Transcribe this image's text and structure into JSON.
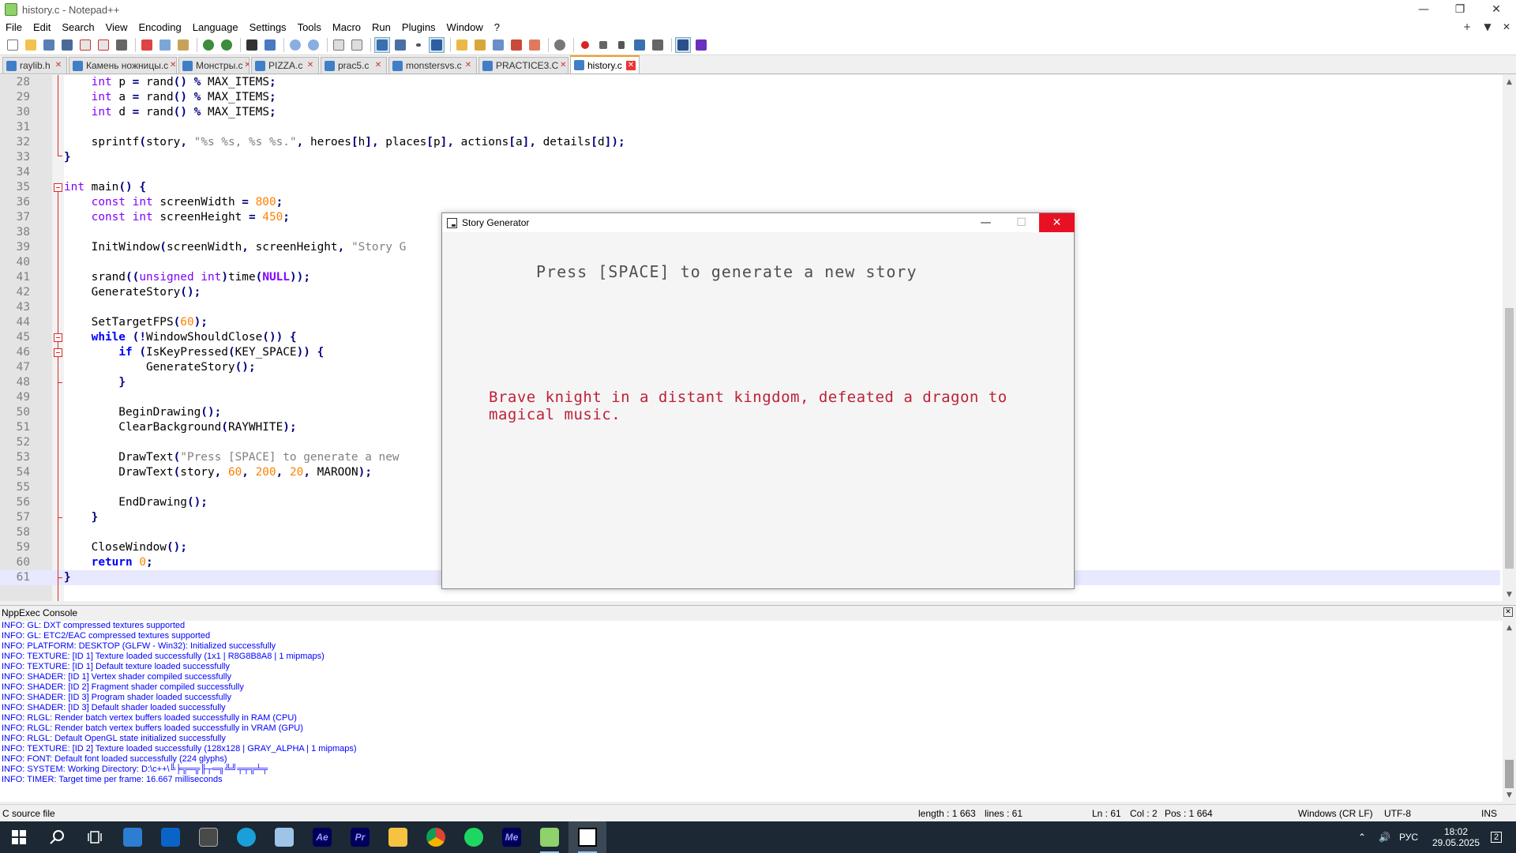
{
  "window": {
    "title": "history.c - Notepad++",
    "minimize_icon": "minimize-icon",
    "restore_icon": "restore-icon",
    "close_icon": "close-icon"
  },
  "menu": {
    "items": [
      "File",
      "Edit",
      "Search",
      "View",
      "Encoding",
      "Language",
      "Settings",
      "Tools",
      "Macro",
      "Run",
      "Plugins",
      "Window",
      "?"
    ],
    "right_controls": [
      "+",
      "▼",
      "✕"
    ]
  },
  "tabs": [
    {
      "label": "raylib.h",
      "active": false
    },
    {
      "label": "Камень ножницы.c",
      "active": false
    },
    {
      "label": "Монстры.c",
      "active": false
    },
    {
      "label": "PIZZA.c",
      "active": false
    },
    {
      "label": "prac5.c",
      "active": false
    },
    {
      "label": "monstersvs.c",
      "active": false
    },
    {
      "label": "PRACTICE3.C",
      "active": false
    },
    {
      "label": "history.c",
      "active": true
    }
  ],
  "editor": {
    "current_line": 61,
    "lines": [
      {
        "n": "28",
        "code": "    int p = rand() % MAX_ITEMS;"
      },
      {
        "n": "29",
        "code": "    int a = rand() % MAX_ITEMS;"
      },
      {
        "n": "30",
        "code": "    int d = rand() % MAX_ITEMS;"
      },
      {
        "n": "31",
        "code": ""
      },
      {
        "n": "32",
        "code": "    sprintf(story, \"%s %s, %s %s.\", heroes[h], places[p], actions[a], details[d]);"
      },
      {
        "n": "33",
        "code": "}"
      },
      {
        "n": "34",
        "code": ""
      },
      {
        "n": "35",
        "code": "int main() {"
      },
      {
        "n": "36",
        "code": "    const int screenWidth = 800;"
      },
      {
        "n": "37",
        "code": "    const int screenHeight = 450;"
      },
      {
        "n": "38",
        "code": ""
      },
      {
        "n": "39",
        "code": "    InitWindow(screenWidth, screenHeight, \"Story G"
      },
      {
        "n": "40",
        "code": ""
      },
      {
        "n": "41",
        "code": "    srand((unsigned int)time(NULL));"
      },
      {
        "n": "42",
        "code": "    GenerateStory();"
      },
      {
        "n": "43",
        "code": ""
      },
      {
        "n": "44",
        "code": "    SetTargetFPS(60);"
      },
      {
        "n": "45",
        "code": "    while (!WindowShouldClose()) {"
      },
      {
        "n": "46",
        "code": "        if (IsKeyPressed(KEY_SPACE)) {"
      },
      {
        "n": "47",
        "code": "            GenerateStory();"
      },
      {
        "n": "48",
        "code": "        }"
      },
      {
        "n": "49",
        "code": ""
      },
      {
        "n": "50",
        "code": "        BeginDrawing();"
      },
      {
        "n": "51",
        "code": "        ClearBackground(RAYWHITE);"
      },
      {
        "n": "52",
        "code": ""
      },
      {
        "n": "53",
        "code": "        DrawText(\"Press [SPACE] to generate a new"
      },
      {
        "n": "54",
        "code": "        DrawText(story, 60, 200, 20, MAROON);"
      },
      {
        "n": "55",
        "code": ""
      },
      {
        "n": "56",
        "code": "        EndDrawing();"
      },
      {
        "n": "57",
        "code": "    }"
      },
      {
        "n": "58",
        "code": ""
      },
      {
        "n": "59",
        "code": "    CloseWindow();"
      },
      {
        "n": "60",
        "code": "    return 0;"
      },
      {
        "n": "61",
        "code": "}"
      }
    ]
  },
  "raylib_window": {
    "title": "Story Generator",
    "prompt": "Press [SPACE] to generate a new story",
    "story": "Brave knight in a distant kingdom, defeated a dragon to magical music.",
    "prompt_color": "#505050",
    "story_color": "#be2137"
  },
  "console": {
    "title": "NppExec Console",
    "lines": [
      "INFO: GL: DXT compressed textures supported",
      "INFO: GL: ETC2/EAC compressed textures supported",
      "INFO: PLATFORM: DESKTOP (GLFW - Win32): Initialized successfully",
      "INFO: TEXTURE: [ID 1] Texture loaded successfully (1x1 | R8G8B8A8 | 1 mipmaps)",
      "INFO: TEXTURE: [ID 1] Default texture loaded successfully",
      "INFO: SHADER: [ID 1] Vertex shader compiled successfully",
      "INFO: SHADER: [ID 2] Fragment shader compiled successfully",
      "INFO: SHADER: [ID 3] Program shader loaded successfully",
      "INFO: SHADER: [ID 3] Default shader loaded successfully",
      "INFO: RLGL: Render batch vertex buffers loaded successfully in RAM (CPU)",
      "INFO: RLGL: Render batch vertex buffers loaded successfully in VRAM (GPU)",
      "INFO: RLGL: Default OpenGL state initialized successfully",
      "INFO: TEXTURE: [ID 2] Texture loaded successfully (128x128 | GRAY_ALPHA | 1 mipmaps)",
      "INFO: FONT: Default font loaded successfully (224 glyphs)",
      "INFO: SYSTEM: Working Directory: D:\\c++\\╚╞╦═╦╟┬═╗╩╝╤╤╦╧╤",
      "INFO: TIMER: Target time per frame: 16.667 milliseconds"
    ]
  },
  "status": {
    "file_type": "C source file",
    "length": "length : 1 663",
    "lines": "lines : 61",
    "ln": "Ln : 61",
    "col": "Col : 2",
    "pos": "Pos : 1 664",
    "eol": "Windows (CR LF)",
    "encoding": "UTF-8",
    "mode": "INS"
  },
  "taskbar": {
    "apps": [
      "start-icon",
      "search-icon",
      "task-view-icon",
      "store-icon",
      "outlook-icon",
      "calculator-icon",
      "edge-icon",
      "notepad-icon",
      "after-effects-icon",
      "premiere-icon",
      "explorer-icon",
      "chrome-icon",
      "spotify-icon",
      "media-encoder-icon",
      "notepadpp-icon",
      "raylib-icon"
    ],
    "ae_label": "Ae",
    "pr_label": "Pr",
    "me_label": "Me",
    "lang": "РУС",
    "time": "18:02",
    "date": "29.05.2025",
    "notifications": "2"
  }
}
